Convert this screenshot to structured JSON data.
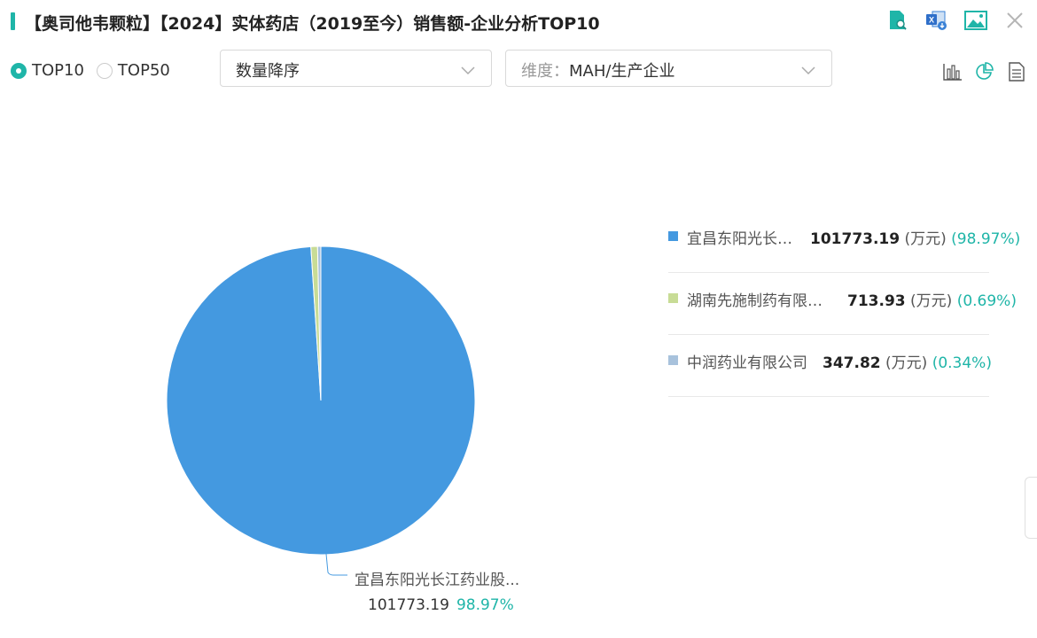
{
  "header": {
    "title": "【奥司他韦颗粒】【2024】实体药店（2019至今）销售额-企业分析TOP10",
    "icons": [
      "doc-search-icon",
      "excel-export-icon",
      "image-export-icon",
      "close-icon"
    ]
  },
  "toolbar": {
    "radios": [
      {
        "label": "TOP10",
        "checked": true
      },
      {
        "label": "TOP50",
        "checked": false
      }
    ],
    "sort_select": "数量降序",
    "dimension_prefix": "维度：",
    "dimension_value": "MAH/生产企业",
    "view_icons": [
      "bar-chart-icon",
      "pie-chart-icon",
      "document-list-icon"
    ]
  },
  "legend": [
    {
      "name": "宜昌东阳光长…",
      "value": "101773.19",
      "unit": "(万元)",
      "pct": "(98.97%)",
      "color": "#4499e0"
    },
    {
      "name": "湖南先施制药有限…",
      "value": "713.93",
      "unit": "(万元)",
      "pct": "(0.69%)",
      "color": "#c8dc96"
    },
    {
      "name": "中润药业有限公司",
      "value": "347.82",
      "unit": "(万元)",
      "pct": "(0.34%)",
      "color": "#a8c2dc"
    }
  ],
  "callout": {
    "name": "宜昌东阳光长江药业股...",
    "value": "101773.19",
    "pct": "98.97%"
  },
  "chart_data": {
    "type": "pie",
    "labels": [
      "宜昌东阳光长江药业股...",
      "湖南先施制药有限…",
      "中润药业有限公司"
    ],
    "values": [
      101773.19,
      713.93,
      347.82
    ],
    "percents": [
      98.97,
      0.69,
      0.34
    ],
    "colors": [
      "#4499e0",
      "#c8dc96",
      "#a8c2dc"
    ],
    "unit": "万元",
    "legend_position": "right"
  }
}
